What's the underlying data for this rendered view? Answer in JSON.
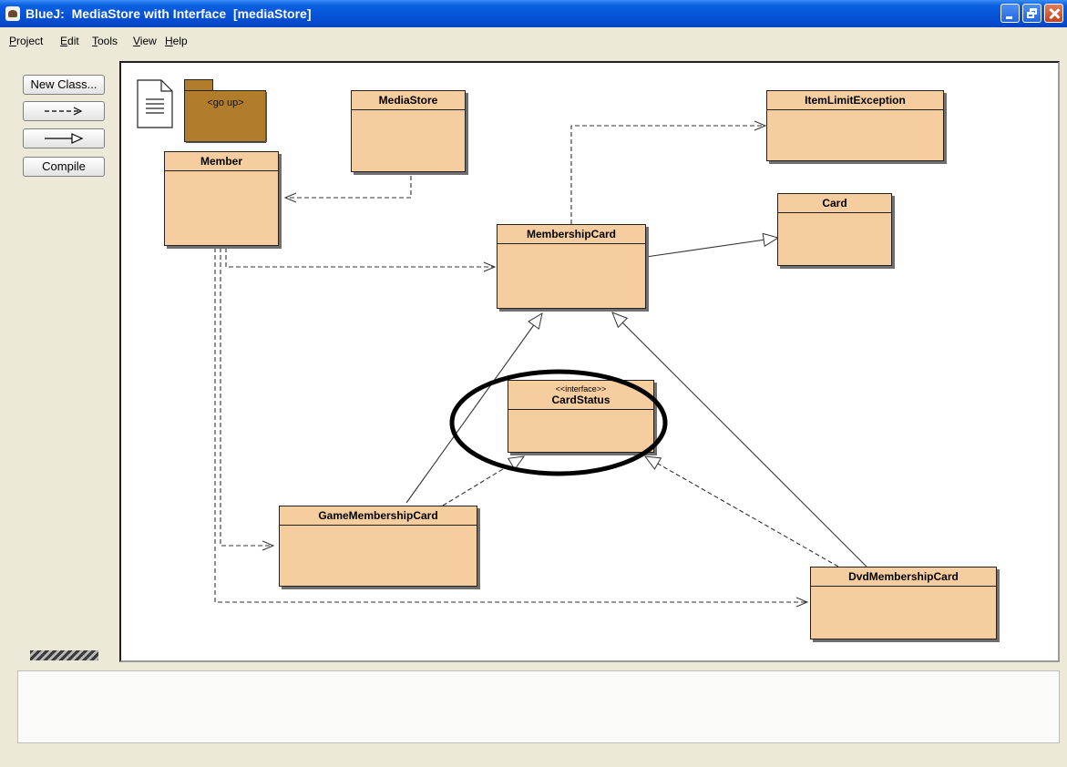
{
  "window": {
    "title": "BlueJ:  MediaStore with Interface  [mediaStore]",
    "colors": {
      "titlebar": "#0552d6",
      "class_fill": "#f5cd9f",
      "package_fill": "#b17d2a"
    }
  },
  "menu": [
    "Project",
    "Edit",
    "Tools",
    "View",
    "Help"
  ],
  "toolbar": {
    "new_class": "New Class...",
    "dependency_arrow": "dependency-arrow",
    "inheritance_arrow": "inheritance-arrow",
    "compile": "Compile"
  },
  "diagram": {
    "package_label": "<go up>",
    "classes": {
      "media_store": {
        "name": "MediaStore"
      },
      "item_limit_exception": {
        "name": "ItemLimitException"
      },
      "member": {
        "name": "Member"
      },
      "card": {
        "name": "Card"
      },
      "membership_card": {
        "name": "MembershipCard"
      },
      "card_status": {
        "stereotype": "<<interface>>",
        "name": "CardStatus",
        "highlighted": true
      },
      "game_membership_card": {
        "name": "GameMembershipCard"
      },
      "dvd_membership_card": {
        "name": "DvdMembershipCard"
      }
    },
    "relations": [
      {
        "from": "MediaStore",
        "to": "Member",
        "type": "uses"
      },
      {
        "from": "MembershipCard",
        "to": "ItemLimitException",
        "type": "uses"
      },
      {
        "from": "MembershipCard",
        "to": "Card",
        "type": "inherits"
      },
      {
        "from": "Member",
        "to": "MembershipCard",
        "type": "uses"
      },
      {
        "from": "Member",
        "to": "GameMembershipCard",
        "type": "uses"
      },
      {
        "from": "Member",
        "to": "DvdMembershipCard",
        "type": "uses"
      },
      {
        "from": "GameMembershipCard",
        "to": "MembershipCard",
        "type": "inherits"
      },
      {
        "from": "DvdMembershipCard",
        "to": "MembershipCard",
        "type": "inherits"
      },
      {
        "from": "GameMembershipCard",
        "to": "CardStatus",
        "type": "implements"
      },
      {
        "from": "DvdMembershipCard",
        "to": "CardStatus",
        "type": "implements"
      }
    ]
  },
  "output": {
    "text": ""
  }
}
